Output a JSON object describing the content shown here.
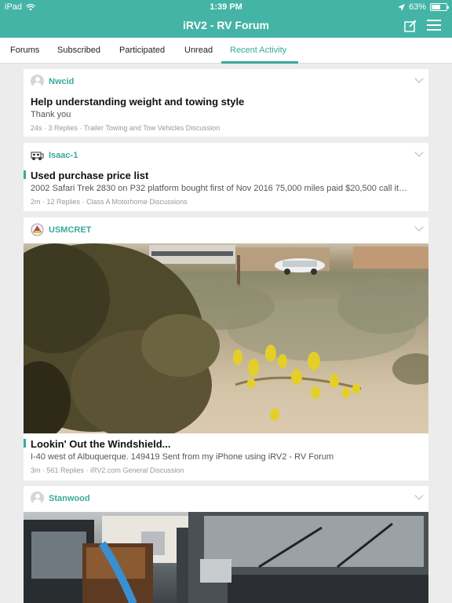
{
  "status": {
    "carrier": "iPad",
    "time": "1:39 PM",
    "battery": "63%",
    "battery_level": 0.63
  },
  "nav": {
    "title": "iRV2 - RV Forum"
  },
  "tabs": [
    "Forums",
    "Subscribed",
    "Participated",
    "Unread",
    "Recent Activity"
  ],
  "active_tab": "Recent Activity",
  "posts": [
    {
      "user": "Nwcid",
      "title": "Help understanding weight and towing style",
      "excerpt": "Thank you",
      "meta": "24s · 3 Replies · Trailer Towing and Tow Vehicles Discussion"
    },
    {
      "user": "Isaac-1",
      "title": "Used purchase price list",
      "excerpt": "2002 Safari Trek 2830 on P32 platform bought first of Nov 2016 75,000 miles paid $20,500 call it…",
      "meta": "2m · 12 Replies · Class A Motorhome Discussions"
    },
    {
      "user": "USMCRET",
      "title": "Lookin' Out the Windshield...",
      "excerpt": "I-40 west of Albuquerque. 149419 Sent from my iPhone using iRV2 - RV Forum",
      "meta": "3m · 561 Replies · iRV2.com General Discussion"
    },
    {
      "user": "Stanwood"
    }
  ]
}
